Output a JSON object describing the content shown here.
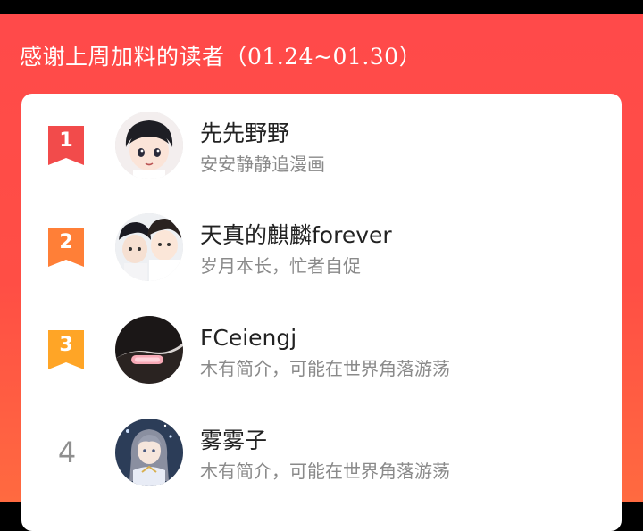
{
  "header": {
    "title": "感谢上周加料的读者（01.24~01.30）"
  },
  "colors": {
    "background_top": "#ff4a4a",
    "background_bottom": "#ff6a40",
    "rank1": "#f24b4b",
    "rank2": "#ff7f37",
    "rank3": "#ffa526",
    "rank_plain": "#8f8f8f"
  },
  "readers": [
    {
      "rank": "1",
      "name": "先先野野",
      "bio": "安安静静追漫画",
      "avatar_icon": "avatar-cartoon-boy"
    },
    {
      "rank": "2",
      "name": "天真的麒麟forever",
      "bio": "岁月本长，忙者自促",
      "avatar_icon": "avatar-two-boys"
    },
    {
      "rank": "3",
      "name": "FCeiengj",
      "bio": "木有简介，可能在世界角落游荡",
      "avatar_icon": "avatar-hairclip"
    },
    {
      "rank": "4",
      "name": "雾雾子",
      "bio": "木有简介，可能在世界角落游荡",
      "avatar_icon": "avatar-anime-girl"
    }
  ]
}
